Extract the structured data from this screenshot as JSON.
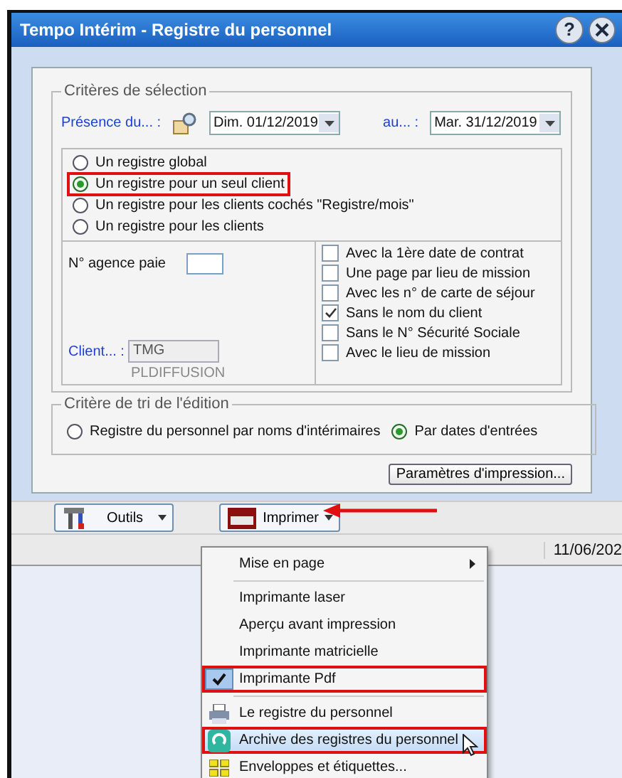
{
  "window": {
    "title": "Tempo Intérim - Registre du personnel",
    "help_glyph": "?"
  },
  "selection": {
    "legend": "Critères de sélection",
    "presence_label": "Présence du... :",
    "date_from": "Dim. 01/12/2019",
    "to_label": "au... :",
    "date_to": "Mar. 31/12/2019",
    "register_options": [
      {
        "label": "Un registre global",
        "selected": false,
        "highlighted": false
      },
      {
        "label": "Un registre pour un seul client",
        "selected": true,
        "highlighted": true
      },
      {
        "label": "Un registre pour les clients cochés \"Registre/mois\"",
        "selected": false,
        "highlighted": false
      },
      {
        "label": "Un registre pour les clients",
        "selected": false,
        "highlighted": false
      }
    ],
    "agency_label": "N° agence paie",
    "client_label": "Client... :",
    "client_value": "TMG",
    "client_name": "PLDIFFUSION",
    "options": [
      {
        "label": "Avec la 1ère date de contrat",
        "checked": false
      },
      {
        "label": "Une page par lieu de mission",
        "checked": false
      },
      {
        "label": "Avec les n° de carte de séjour",
        "checked": false
      },
      {
        "label": "Sans le nom du client",
        "checked": true
      },
      {
        "label": "Sans le N° Sécurité Sociale",
        "checked": false
      },
      {
        "label": "Avec le lieu de mission",
        "checked": false
      }
    ]
  },
  "sort": {
    "legend": "Critère de tri de l'édition",
    "options": [
      {
        "label": "Registre du personnel par noms d'intérimaires",
        "selected": false
      },
      {
        "label": "Par dates d'entrées",
        "selected": true
      }
    ]
  },
  "print_settings_button": "Paramètres d'impression...",
  "toolbar": [
    {
      "kind": "tools",
      "label": "Outils",
      "pointed": false
    },
    {
      "kind": "print",
      "label": "Imprimer",
      "pointed": true
    }
  ],
  "status_bar": {
    "date": "11/06/202"
  },
  "menu": [
    {
      "kind": "submenu",
      "label": "Mise en page"
    },
    {
      "kind": "separator"
    },
    {
      "kind": "option",
      "label": "Imprimante laser",
      "checked": false,
      "highlighted": false
    },
    {
      "kind": "option",
      "label": "Aperçu avant impression",
      "checked": false,
      "highlighted": false
    },
    {
      "kind": "option",
      "label": "Imprimante matricielle",
      "checked": false,
      "highlighted": false
    },
    {
      "kind": "option",
      "label": "Imprimante Pdf",
      "checked": true,
      "highlighted": true
    },
    {
      "kind": "separator"
    },
    {
      "kind": "command",
      "label": "Le registre du personnel",
      "hovered": false,
      "highlighted": false
    },
    {
      "kind": "command",
      "label": "Archive des registres du personnel",
      "hovered": true,
      "highlighted": true
    },
    {
      "kind": "command",
      "label": "Enveloppes et étiquettes...",
      "hovered": false,
      "highlighted": false
    }
  ]
}
